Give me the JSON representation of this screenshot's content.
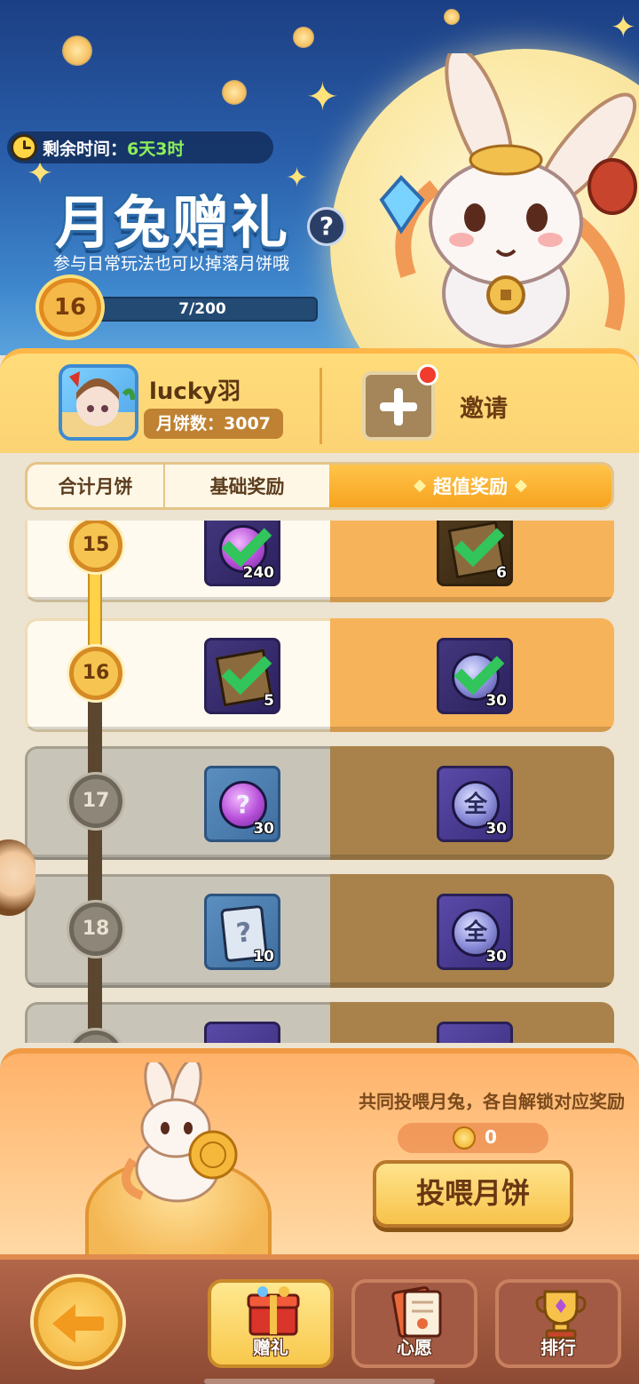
{
  "banner": {
    "timer_label": "剩余时间：",
    "timer_value": "6天3时",
    "title": "月兔赠礼",
    "help": "?",
    "subtitle": "参与日常玩法也可以掉落月饼哦",
    "level": "16",
    "progress_text": "7/200",
    "progress_fraction": 0.035
  },
  "user": {
    "name": "lucky羽",
    "mooncake_count": "月饼数：3007",
    "invite_label": "邀请"
  },
  "tabs": [
    "合计月饼",
    "基础奖励",
    "超值奖励"
  ],
  "rewards": [
    {
      "level": "15",
      "basic_count": "240",
      "premium_count": "6"
    },
    {
      "level": "16",
      "basic_count": "5",
      "premium_count": "30"
    },
    {
      "level": "17",
      "basic_count": "30",
      "premium_count": "30",
      "premium_glyph": "全",
      "basic_glyph": "?"
    },
    {
      "level": "18",
      "basic_count": "10",
      "premium_count": "30",
      "premium_glyph": "全",
      "basic_glyph": "?"
    }
  ],
  "feed": {
    "hint": "共同投喂月兔，各自解锁对应奖励",
    "coin_count": "0",
    "button": "投喂月饼"
  },
  "bottom_nav": [
    {
      "label": "赠礼",
      "icon": "gift-chest-icon",
      "active": true
    },
    {
      "label": "心愿",
      "icon": "wish-card-icon",
      "active": false
    },
    {
      "label": "排行",
      "icon": "trophy-icon",
      "active": false
    }
  ],
  "colors": {
    "accent_orange": "#f7a31f",
    "progress_green": "#8df05a",
    "check_green": "#31c55b",
    "notification_red": "#f03b2d"
  }
}
